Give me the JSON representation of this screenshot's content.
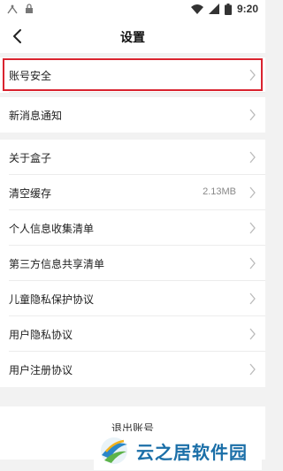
{
  "status_bar": {
    "time": "9:20",
    "icons": [
      "signal-icon",
      "lock-icon",
      "wifi-icon",
      "cellular-icon",
      "battery-icon"
    ]
  },
  "header": {
    "title": "设置",
    "back_icon": "chevron-left-icon"
  },
  "settings": {
    "items": [
      {
        "label": "账号安全",
        "value": ""
      },
      {
        "label": "新消息通知",
        "value": ""
      },
      {
        "label": "关于盒子",
        "value": ""
      },
      {
        "label": "清空缓存",
        "value": "2.13MB"
      },
      {
        "label": "个人信息收集清单",
        "value": ""
      },
      {
        "label": "第三方信息共享清单",
        "value": ""
      },
      {
        "label": "儿童隐私保护协议",
        "value": ""
      },
      {
        "label": "用户隐私协议",
        "value": ""
      },
      {
        "label": "用户注册协议",
        "value": ""
      }
    ]
  },
  "logout": {
    "label": "退出账号"
  },
  "watermark": {
    "text": "云之居软件园"
  },
  "colors": {
    "highlight": "#d9232f",
    "watermark": "#1b6fa8"
  }
}
